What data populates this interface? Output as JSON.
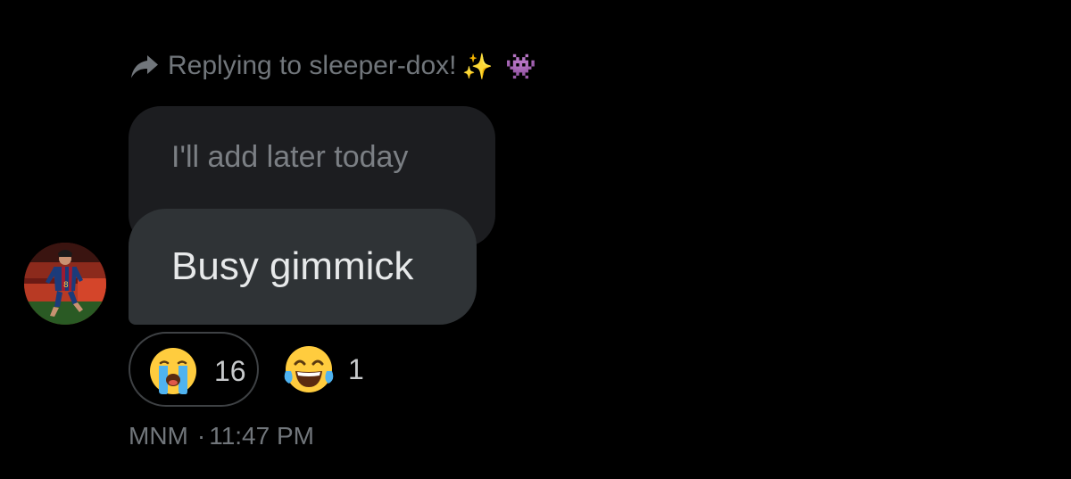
{
  "reply_context": {
    "label": "Replying to sleeper-dox!",
    "emoji_sparkles": "✨",
    "emoji_invader": "👾"
  },
  "messages": {
    "quoted_text": "I'll add later today",
    "main_text": "Busy gimmick"
  },
  "reactions": [
    {
      "emoji": "loudly-crying-face",
      "count": "16",
      "selected": true
    },
    {
      "emoji": "face-with-tears-of-joy",
      "count": "1",
      "selected": false
    }
  ],
  "meta": {
    "sender": "MNM",
    "separator": "·",
    "time": "11:47 PM"
  },
  "colors": {
    "background": "#000000",
    "secondary_text": "#71767b",
    "quoted_bubble": "#1c1d20",
    "main_bubble": "#2f3336",
    "primary_text": "#e7e9ea"
  }
}
